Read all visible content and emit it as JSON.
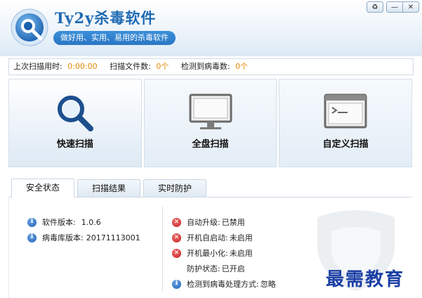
{
  "app": {
    "title": "Ty2y杀毒软件",
    "slogan": "做好用、实用、易用的杀毒软件"
  },
  "window_controls": {
    "skin_icon": "refresh-icon",
    "minimize": "—",
    "close": "✕"
  },
  "status": {
    "last_scan_time_label": "上次扫描用时:",
    "last_scan_time_value": "0:00:00",
    "scanned_files_label": "扫描文件数:",
    "scanned_files_value": "0个",
    "virus_found_label": "检测到病毒数:",
    "virus_found_value": "0个"
  },
  "scan_buttons": [
    {
      "label": "快速扫描",
      "icon": "magnifier-icon"
    },
    {
      "label": "全盘扫描",
      "icon": "monitor-icon"
    },
    {
      "label": "自定义扫描",
      "icon": "terminal-icon"
    }
  ],
  "tabs": [
    {
      "label": "安全状态"
    },
    {
      "label": "扫描结果"
    },
    {
      "label": "实时防护"
    }
  ],
  "info_left": [
    {
      "label": "软件版本:",
      "value": "1.0.6",
      "icon": "info-icon"
    },
    {
      "label": "病毒库版本:",
      "value": "20171113001",
      "icon": "info-icon"
    }
  ],
  "info_right": [
    {
      "label": "自动升级:",
      "value": "已禁用",
      "icon": "error-icon"
    },
    {
      "label": "开机自启动:",
      "value": "未启用",
      "icon": "error-icon"
    },
    {
      "label": "开机最小化:",
      "value": "未启用",
      "icon": "error-icon"
    },
    {
      "label": "防护状态:",
      "value": "已开启",
      "icon": "none"
    },
    {
      "label": "检测到病毒处理方式:",
      "value": "忽略",
      "icon": "info-icon"
    }
  ],
  "watermark": "最需教育",
  "colors": {
    "accent": "#1f6ab3",
    "value_orange": "#e78a00",
    "error_red": "#c42020"
  }
}
